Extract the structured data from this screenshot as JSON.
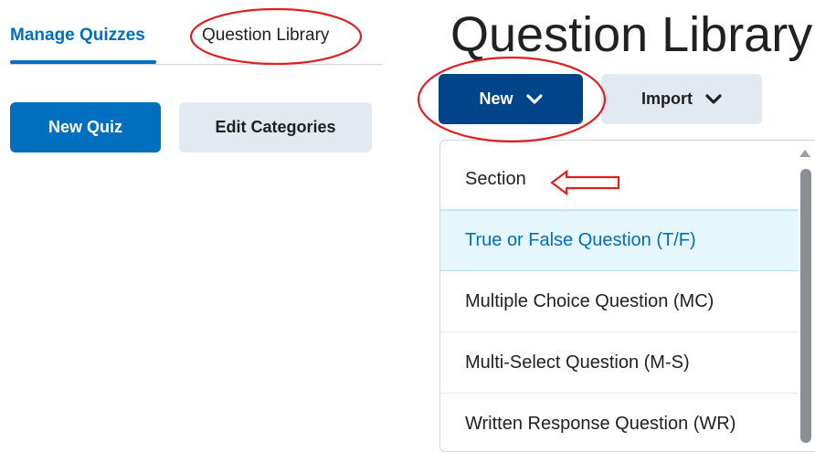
{
  "tabs": {
    "manage_quizzes": "Manage Quizzes",
    "question_library": "Question Library"
  },
  "buttons": {
    "new_quiz": "New Quiz",
    "edit_categories": "Edit Categories",
    "new": "New",
    "import": "Import"
  },
  "page_title": "Question Library",
  "dropdown": {
    "items": [
      "Section",
      "True or False Question (T/F)",
      "Multiple Choice Question (MC)",
      "Multi-Select Question (M-S)",
      "Written Response Question (WR)"
    ],
    "highlighted_index": 1
  },
  "colors": {
    "accent": "#006fbf",
    "new_button": "#004489",
    "annotation": "#e02020"
  }
}
